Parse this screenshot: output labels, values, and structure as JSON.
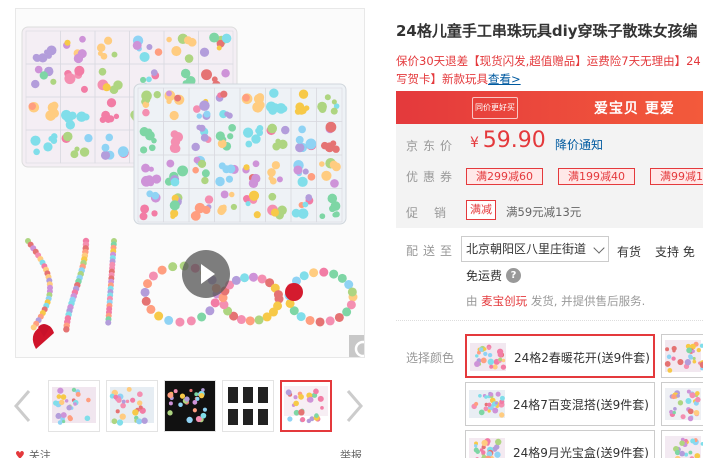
{
  "product": {
    "title": "24格儿童手工串珠玩具diy穿珠子散珠女孩编",
    "promo_text": "保价30天退差【现货闪发,超值赠品】运费险7天无理由】24",
    "promo_text2": "写贺卡】新款玩具",
    "promo_link": "查看>"
  },
  "banner": {
    "logo": "同价更好买",
    "slogan": "爱宝贝 更爱"
  },
  "price": {
    "label": "京东价",
    "currency": "¥",
    "value": "59.90",
    "notice": "降价通知"
  },
  "coupons": {
    "label": "优惠券",
    "items": [
      "满299减60",
      "满199减40",
      "满99减1"
    ]
  },
  "promotion": {
    "label": "促销",
    "tag": "满减",
    "text": "满59元减13元"
  },
  "shipping": {
    "label": "配送至",
    "address": "北京朝阳区八里庄街道",
    "stock": "有货",
    "support": "支持 免",
    "free": "免运费",
    "help": "?",
    "seller_prefix": "由",
    "seller_name": "麦宝创玩",
    "seller_suffix": "发货, 并提供售后服务."
  },
  "colors": {
    "label": "选择颜色",
    "options": [
      "24格2春暖花开(送9件套)",
      "24格7百变混搭(送9件套)",
      "24格9月光宝盒(送9件套)"
    ],
    "selected": 0
  },
  "gallery": {
    "thumbnails": [
      "thumb-1",
      "thumb-2",
      "thumb-3",
      "thumb-4",
      "thumb-5"
    ],
    "active": 4,
    "follow": "关注",
    "report": "举报"
  },
  "colors_palette": {
    "accent": "#e4393c",
    "link": "#005aa0"
  }
}
